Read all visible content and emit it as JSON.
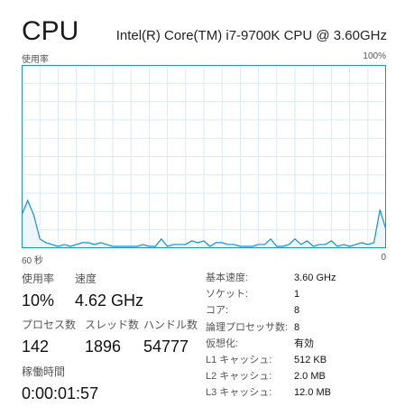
{
  "header": {
    "title": "CPU",
    "model": "Intel(R) Core(TM) i7-9700K CPU @ 3.60GHz"
  },
  "chart": {
    "top_left_label": "使用率",
    "top_right_label": "100%",
    "bottom_left_label": "60 秒",
    "bottom_right_label": "0",
    "line_color": "#1191d6",
    "fill_color": "#eef6fb",
    "grid_color": "#dbe9f3",
    "border_color": "#1f93d2"
  },
  "chart_data": {
    "type": "area",
    "x": [
      0,
      1,
      2,
      3,
      4,
      5,
      6,
      7,
      8,
      9,
      10,
      11,
      12,
      13,
      14,
      15,
      16,
      17,
      18,
      19,
      20,
      21,
      22,
      23,
      24,
      25,
      26,
      27,
      28,
      29,
      30,
      31,
      32,
      33,
      34,
      35,
      36,
      37,
      38,
      39,
      40,
      41,
      42,
      43,
      44,
      45,
      46,
      47,
      48,
      49,
      50,
      51,
      52,
      53,
      54,
      55,
      56,
      57,
      58,
      59,
      60
    ],
    "y": [
      18,
      26,
      18,
      5,
      3,
      2,
      1,
      2,
      1,
      2,
      3,
      3,
      2,
      3,
      2,
      1,
      1,
      1,
      1,
      1,
      2,
      1,
      1,
      5,
      1,
      2,
      2,
      2,
      4,
      3,
      4,
      1,
      3,
      3,
      2,
      2,
      1,
      1,
      1,
      2,
      2,
      5,
      1,
      1,
      2,
      5,
      2,
      4,
      1,
      2,
      2,
      4,
      1,
      2,
      1,
      2,
      3,
      2,
      3,
      21,
      10
    ],
    "ylim": [
      0,
      100
    ],
    "xlim": [
      0,
      60
    ],
    "grid": true,
    "series": [
      {
        "values": [
          18,
          26,
          18,
          5,
          3,
          2,
          1,
          2,
          1,
          2,
          3,
          3,
          2,
          3,
          2,
          1,
          1,
          1,
          1,
          1,
          2,
          1,
          1,
          5,
          1,
          2,
          2,
          2,
          4,
          3,
          4,
          1,
          3,
          3,
          2,
          2,
          1,
          1,
          1,
          2,
          2,
          5,
          1,
          1,
          2,
          5,
          2,
          4,
          1,
          2,
          2,
          4,
          1,
          2,
          1,
          2,
          3,
          2,
          3,
          21,
          10
        ]
      }
    ]
  },
  "stats": {
    "usage_label": "使用率",
    "usage_value": "10%",
    "speed_label": "速度",
    "speed_value": "4.62 GHz",
    "processes_label": "プロセス数",
    "processes_value": "142",
    "threads_label": "スレッド数",
    "threads_value": "1896",
    "handles_label": "ハンドル数",
    "handles_value": "54777",
    "uptime_label": "稼働時間",
    "uptime_value": "0:00:01:57"
  },
  "details": [
    {
      "key": "基本速度:",
      "value": "3.60 GHz"
    },
    {
      "key": "ソケット:",
      "value": "1"
    },
    {
      "key": "コア:",
      "value": "8"
    },
    {
      "key": "論理プロセッサ数:",
      "value": "8"
    },
    {
      "key": "仮想化:",
      "value": "有効"
    },
    {
      "key": "L1 キャッシュ:",
      "value": "512 KB"
    },
    {
      "key": "L2 キャッシュ:",
      "value": "2.0 MB"
    },
    {
      "key": "L3 キャッシュ:",
      "value": "12.0 MB"
    }
  ]
}
